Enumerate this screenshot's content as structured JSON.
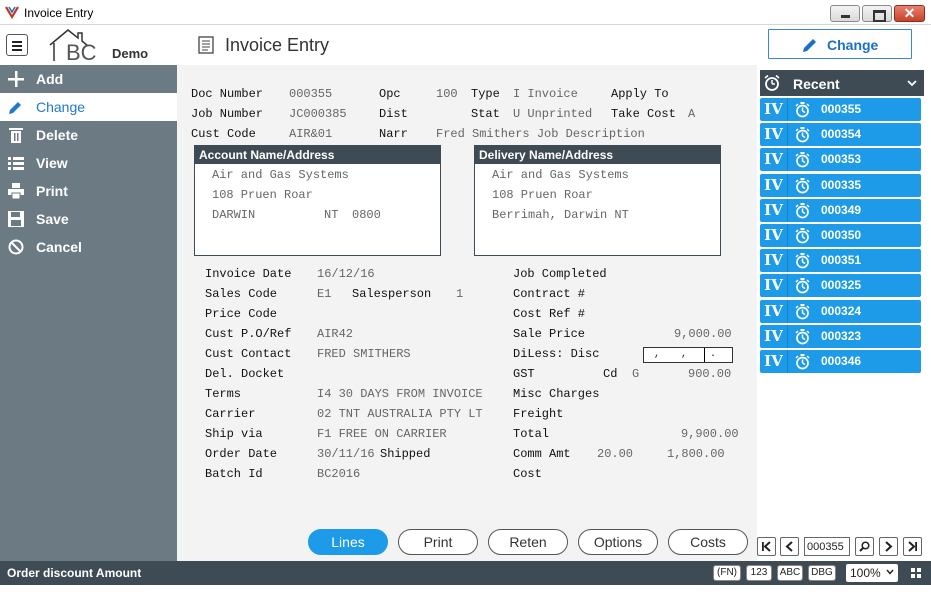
{
  "window": {
    "title": "Invoice Entry"
  },
  "header": {
    "logo_text": "Demo",
    "logo_letters": "BC",
    "page_title": "Invoice Entry",
    "change_label": "Change"
  },
  "sidebar": {
    "items": [
      {
        "label": "Add",
        "icon": "plus-icon"
      },
      {
        "label": "Change",
        "icon": "pencil-icon",
        "active": true
      },
      {
        "label": "Delete",
        "icon": "trash-icon"
      },
      {
        "label": "View",
        "icon": "list-icon"
      },
      {
        "label": "Print",
        "icon": "printer-icon"
      },
      {
        "label": "Save",
        "icon": "floppy-icon"
      },
      {
        "label": "Cancel",
        "icon": "cancel-icon"
      }
    ]
  },
  "form": {
    "doc_number_label": "Doc Number",
    "doc_number": "000355",
    "opc_label": "Opc",
    "opc": "100",
    "type_label": "Type",
    "type": "I Invoice",
    "apply_to_label": "Apply To",
    "job_number_label": "Job Number",
    "job_number": "JC000385",
    "dist_label": "Dist",
    "stat_label": "Stat",
    "stat": "U Unprinted",
    "take_cost_label": "Take Cost",
    "take_cost": "A",
    "cust_code_label": "Cust Code",
    "cust_code": "AIR&01",
    "narr_label": "Narr",
    "narr": "Fred Smithers Job Description",
    "account": {
      "title": "Account Name/Address",
      "line1": "Air and Gas Systems",
      "line2": "108 Pruen Roar",
      "city": "DARWIN",
      "state": "NT",
      "postcode": "0800"
    },
    "delivery": {
      "title": "Delivery Name/Address",
      "line1": "Air and Gas Systems",
      "line2": "108 Pruen Roar",
      "line3": "Berrimah, Darwin NT"
    },
    "invoice_date_label": "Invoice Date",
    "invoice_date": "16/12/16",
    "sales_code_label": "Sales Code",
    "sales_code": "E1",
    "salesperson_label": "Salesperson",
    "salesperson": "1",
    "price_code_label": "Price Code",
    "cust_po_label": "Cust P.O/Ref",
    "cust_po": "AIR42",
    "cust_contact_label": "Cust Contact",
    "cust_contact": "FRED SMITHERS",
    "del_docket_label": "Del. Docket",
    "terms_label": "Terms",
    "terms": "I4 30 DAYS FROM INVOICE",
    "carrier_label": "Carrier",
    "carrier": "02 TNT AUSTRALIA PTY LT",
    "ship_via_label": "Ship via",
    "ship_via": "F1 FREE ON CARRIER",
    "order_date_label": "Order Date",
    "order_date": "30/11/16",
    "shipped_label": "Shipped",
    "batch_id_label": "Batch Id",
    "batch_id": "BC2016",
    "job_completed_label": "Job Completed",
    "contract_label": "Contract #",
    "cost_ref_label": "Cost Ref #",
    "sale_price_label": "Sale Price",
    "sale_price": "9,000.00",
    "diless_label": "DiLess: Disc",
    "gst_label": "GST",
    "cd_label": "Cd",
    "cd": "G",
    "gst": "900.00",
    "misc_label": "Misc Charges",
    "freight_label": "Freight",
    "total_label": "Total",
    "total": "9,900.00",
    "comm_label": "Comm Amt",
    "comm_rate": "20.00",
    "comm_amt": "1,800.00",
    "cost_label": "Cost"
  },
  "tabs": [
    {
      "label": "Lines",
      "active": true
    },
    {
      "label": "Print"
    },
    {
      "label": "Reten"
    },
    {
      "label": "Options"
    },
    {
      "label": "Costs"
    }
  ],
  "recent": {
    "title": "Recent",
    "type_label": "IV",
    "items": [
      "000355",
      "000354",
      "000353",
      "000335",
      "000349",
      "000350",
      "000351",
      "000325",
      "000324",
      "000323",
      "000346"
    ]
  },
  "nav": {
    "record": "000355"
  },
  "status": {
    "message": "Order discount Amount",
    "badges": [
      "(FN)",
      "123",
      "ABC",
      "DBG"
    ],
    "zoom": "100%"
  },
  "colors": {
    "accent": "#1d9be8",
    "sidebar": "#6c7a83",
    "dark": "#3f4b54"
  }
}
